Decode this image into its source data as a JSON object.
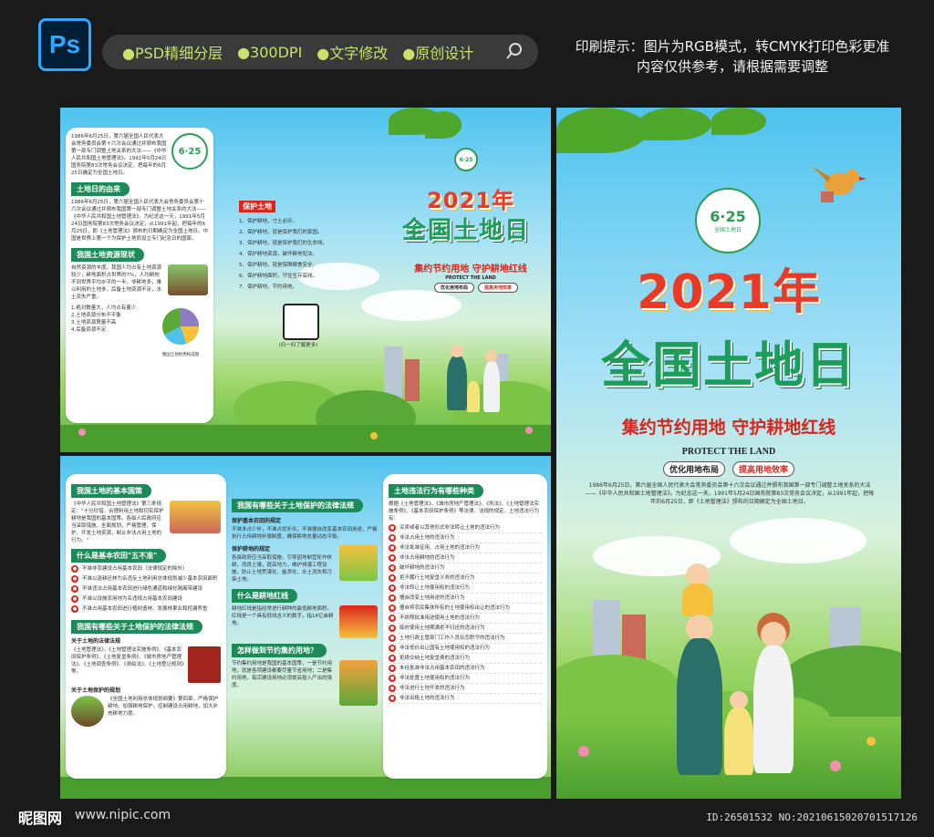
{
  "header": {
    "ps_logo": "Ps",
    "tags": [
      "●PSD精细分层",
      "●300DPI",
      "●文字修改",
      "●原创设计"
    ],
    "print_note_line1": "印刷提示：图片为RGB模式，转CMYK打印色彩更准",
    "print_note_line2": "内容仅供参考，请根据需要调整"
  },
  "footer": {
    "logo": "昵图网",
    "url": "www.nipic.com",
    "id": "ID:26501532 NO:20210615020701517126"
  },
  "cover": {
    "year_title": "2021年",
    "main_title": "全国土地日",
    "slogan": "集约节约用地 守护耕地红线",
    "protect": "PROTECT THE LAND",
    "pill1": "优化用地布局",
    "pill2": "提高用地效率",
    "logo_digits": "6·25",
    "logo_text": "全国土地日",
    "intro": "1986年6月25日，第六届全国人民代表大会常务委员会第十六次会议通过并颁布我国第一部专门调整土地关系的大法——《中华人民共和国土地管理法》。为纪念这一天，1991年5月24日国务院第83次常务会议决定，从1991年起，把每年的6月25日，即《土地管理法》颁布的日期确定为全国土地日。"
  },
  "inside": {
    "intro": "1986年6月25日，第六届全国人民代表大会常务委员会第十六次会议通过并颁布我国第一部专门调整土地关系的大法——《中华人民共和国土地管理法》。1991年5月24日国务院第83次常务会议决定，把每年的6月25日确定为全国土地日。",
    "origin_heading": "土地日的由来",
    "origin_text": "1986年6月25日，第六届全国人民代表大会常务委员会第十六次会议通过并颁布我国第一部专门调整土地关系的大法——《中华人民共和国土地管理法》。为纪念这一天，1991年5月24日国务院第83次常务会议决定，从1991年起，把每年的6月25日，即《土地管理法》颁布的日期确定为全国土地日。中国是世界上第一个为保护土地而设立专门纪念日的国家。",
    "status_heading": "我国土地资源现状",
    "status_text": "自然资源的丰度。我国人均占有土地资源较少，耕地面积占世界的7%，人均耕地不到世界平均水平的一半。非耕地多，难以利用的土地多，后备土地资源不足，水土流失严重。",
    "status_list": [
      "1.绝对数量大，人均占有量少",
      "2.土地资源分布不平衡",
      "3.土地资源质量不高",
      "4.后备资源不足"
    ],
    "pie_caption": "我国土地利用构成图",
    "protect_heading": "保护土地",
    "protect_list": [
      "1、保护耕地，寸土必珍。",
      "2、保护耕地，就是保护我们的家园。",
      "3、保护耕地，就是保护我们的生命线。",
      "4、保护耕地资源，破坏耕地犯法。",
      "5、保护耕地，就是保障粮食安全。",
      "6、保护耕地面积，守住生存底线。",
      "7、保护耕地，节约用地。"
    ],
    "scan": "(扫一扫了解更多)",
    "year_title": "2021年",
    "main_title": "全国土地日",
    "slogan": "集约节约用地 守护耕地红线",
    "protect": "PROTECT THE LAND",
    "pill1": "优化用地布局",
    "pill2": "提高用地效率",
    "logo_digits": "6·25"
  },
  "back": {
    "basic_heading": "我国土地的基本国策",
    "basic_text": "《中华人民共和国土地管理法》第三条规定：\"十分珍惜、合理利用土地和切实保护耕地是我国的基本国策。各级人民政府应当采取措施，全面规划，严格管理，保护、开发土地资源，制止非法占用土地的行为。\"",
    "five_heading": "什么是基本农田\"五不准\"",
    "five_list": [
      "不准非农建设占用基本农田（法律规定的除外）",
      "不准以退耕还林为名违反土地利用总体规划减少基本农田面积",
      "不准违法占用基本农田进行绿色通道和绿化隔离带建设",
      "不准以设施农用地为名违规占用基本农田建设",
      "不准占用基本农田进行植树造林、发展林果业和挖塘养鱼"
    ],
    "laws_heading": "我国有哪些关于土地保护的法律法规",
    "laws_sub1": "关于土地的法律法规",
    "laws_text1": "《土地管理法》、《土地管理法实施条例》、《基本农田保护条例》、《土地复垦条例》、《城市房地产管理法》、《土地调查条例》、《测绘法》、《土地登记规则》等。",
    "laws_sub2": "关于土地保护的规划",
    "laws_text2": "《全国土地利用总体规划纲要》第四章，严格保护耕地。加强耕地保护，控制建设占用耕地，加大补充耕地力度。",
    "mid_heading": "我国有哪些关于土地保护的法律法规",
    "mid_sub1": "保护基本农田的规定",
    "mid_text1": "不准多占少补，不准占优补劣，不准擅自改变基本农田用途，严格执行占用耕地补偿制度，确保耕地总量动态平衡。",
    "mid_sub2": "保护耕地的规定",
    "mid_text2": "各级政府应当采取措施，引导因地制宜轮作休耕，改良土壤，提高地力，维护排灌工程设施，防止土地荒漠化、盐渍化、水土流失和污染土地。",
    "redline_heading": "什么是耕地红线",
    "redline_text": "耕地红线是指经常进行耕种的最低耕地面积。红线是一个具有低线含义的数字，指18亿亩耕地。",
    "save_heading": "怎样做到节约集约用地？",
    "save_text": "节约集约用地是我国的基本国策，一是节约用地，就是各项建设都要尽量节省用地；二是集约用地，每宗建设用地必须提高投入产出的强度。",
    "illegal_heading": "土地违法行为有哪些种类",
    "illegal_intro": "根据《土地管理法》、《城市房地产管理法》、《刑法》、《土地管理法实施条例》、《基本农田保护条例》等法律、法规的规定，土地违法行为有：",
    "illegal_list": [
      "买卖或者以其他形式非法转让土地的违法行为",
      "非法占用土地的违法行为",
      "非法批准征用、占用土地的违法行为",
      "非法占用耕地的违法行为",
      "破坏耕地的违法行为",
      "拒不履行土地复垦义务的违法行为",
      "非法转让土地使用权的违法行为",
      "擅自改变土地用途的违法行为",
      "擅自将农民集体所有的土地使用权出让的违法行为",
      "不依照批准用途使用土地的违法行为",
      "临时使用土地期满拒不归还的违法行为",
      "土地行政主管部门工作人员玩忽职守的违法行为",
      "非法低价出让国有土地使用权的违法行为",
      "拒绝交纳土地复垦费的违法行为",
      "未经批准非法占用基本农田的违法行为",
      "非法处置土地使用权的违法行为",
      "非法进行土地开发的违法行为",
      "非法出租土地的违法行为"
    ]
  }
}
